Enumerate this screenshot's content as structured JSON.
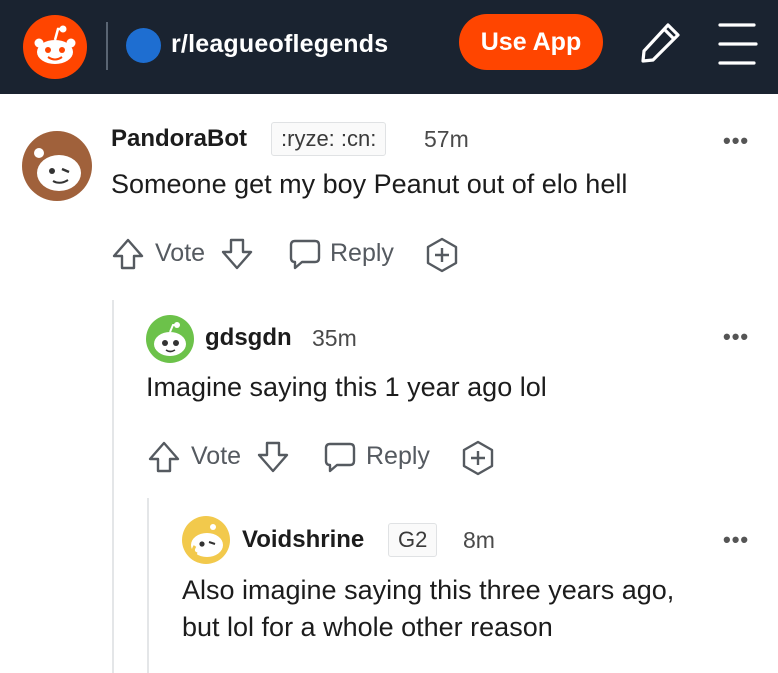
{
  "header": {
    "subreddit": "r/leagueoflegends",
    "use_app_label": "Use App",
    "colors": {
      "bar": "#1a2330",
      "brand": "#ff4500",
      "sub_dot": "#1e6ed1"
    }
  },
  "comments": [
    {
      "username": "PandoraBot",
      "flair": ":ryze: :cn:",
      "time": "57m",
      "body": "Someone get my boy Peanut out of elo hell",
      "vote_label": "Vote",
      "reply_label": "Reply",
      "more_label": "•••"
    },
    {
      "username": "gdsgdn",
      "time": "35m",
      "body": "Imagine saying this 1 year ago lol",
      "vote_label": "Vote",
      "reply_label": "Reply",
      "more_label": "•••"
    },
    {
      "username": "Voidshrine",
      "flair": "G2",
      "time": "8m",
      "body_line1": "Also imagine saying this three years ago,",
      "body_line2": "but lol for a whole other reason",
      "more_label": "•••"
    }
  ]
}
